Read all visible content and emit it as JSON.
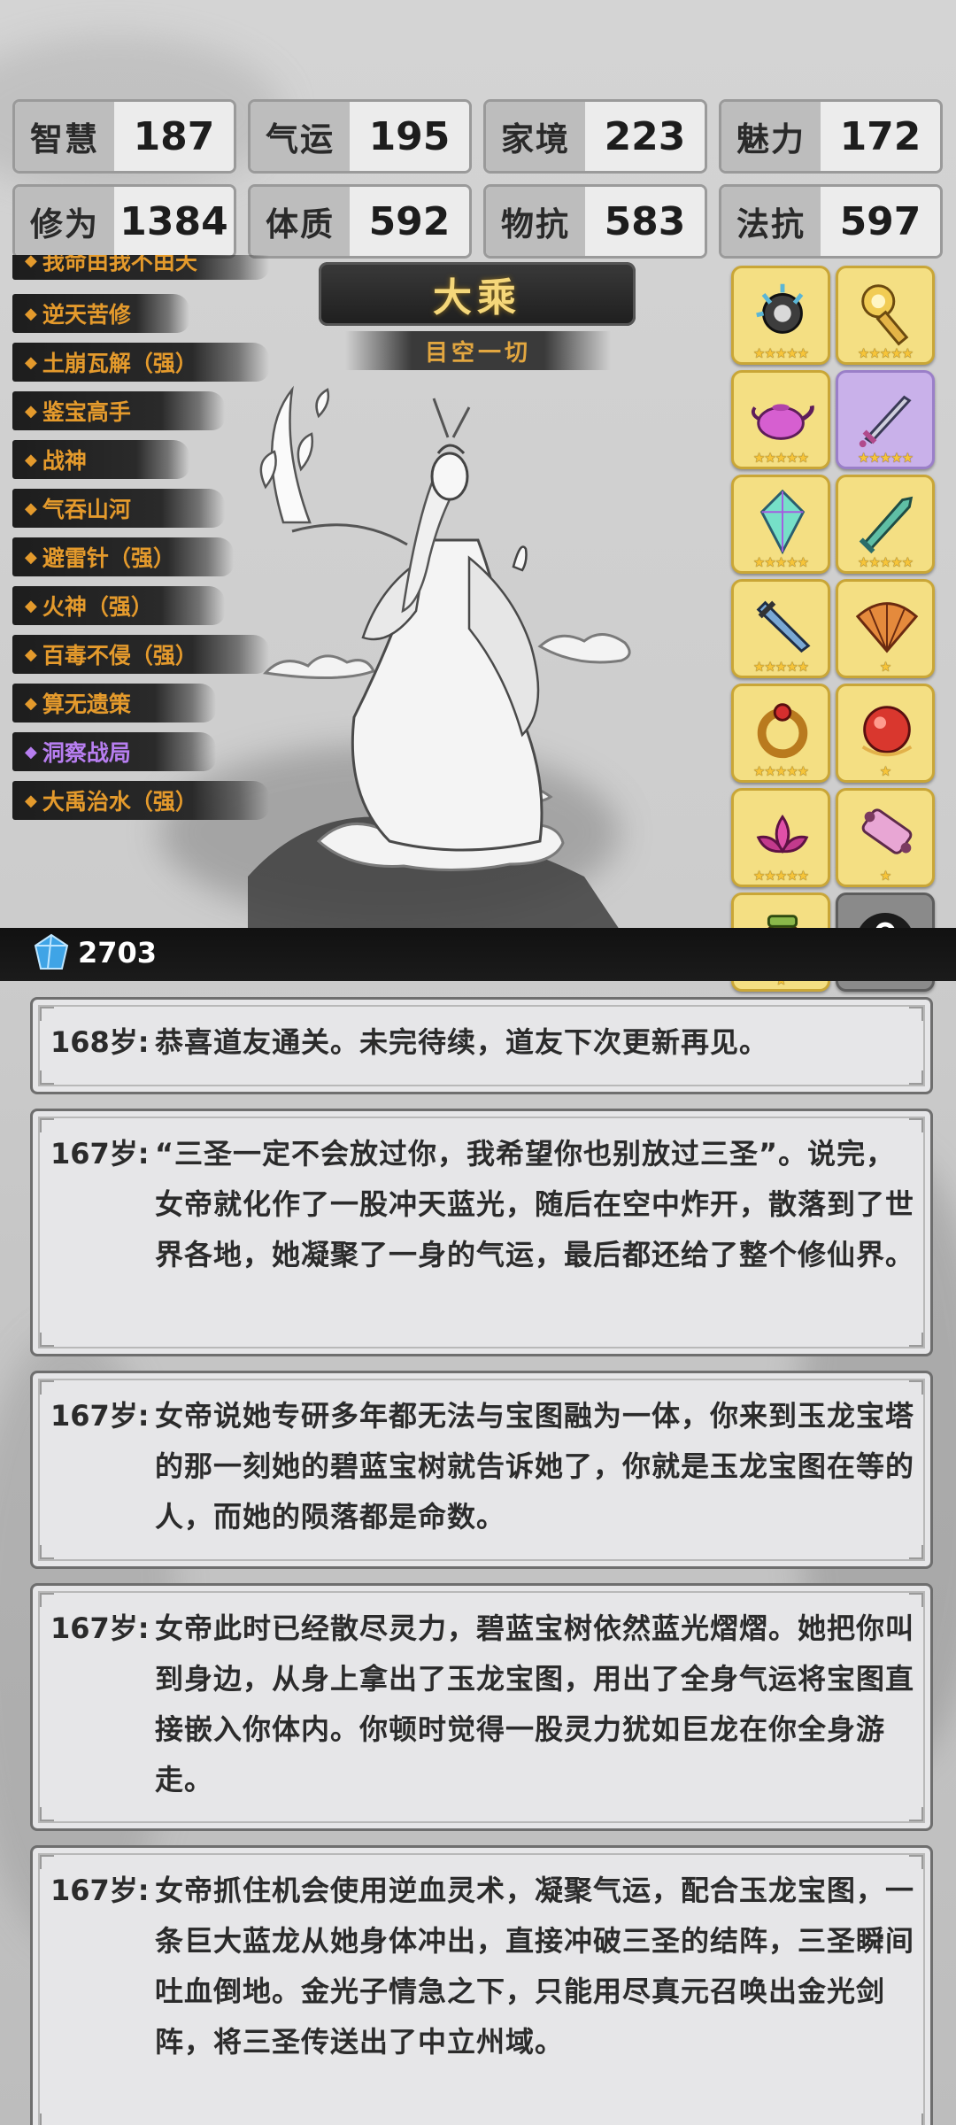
{
  "stats": [
    {
      "label": "智慧",
      "value": "187"
    },
    {
      "label": "气运",
      "value": "195"
    },
    {
      "label": "家境",
      "value": "223"
    },
    {
      "label": "魅力",
      "value": "172"
    },
    {
      "label": "修为",
      "value": "1384"
    },
    {
      "label": "体质",
      "value": "592"
    },
    {
      "label": "物抗",
      "value": "583"
    },
    {
      "label": "法抗",
      "value": "597"
    }
  ],
  "traits": [
    {
      "label": "我命由我不由天",
      "color": "#e49a2c"
    },
    {
      "label": "逆天苦修",
      "color": "#e49a2c"
    },
    {
      "label": "土崩瓦解（强）",
      "color": "#e49a2c"
    },
    {
      "label": "鉴宝高手",
      "color": "#e49a2c"
    },
    {
      "label": "战神",
      "color": "#e49a2c"
    },
    {
      "label": "气吞山河",
      "color": "#e49a2c"
    },
    {
      "label": "避雷针（强）",
      "color": "#e49a2c"
    },
    {
      "label": "火神（强）",
      "color": "#e49a2c"
    },
    {
      "label": "百毒不侵（强）",
      "color": "#e49a2c"
    },
    {
      "label": "算无遗策",
      "color": "#e49a2c"
    },
    {
      "label": "洞察战局",
      "color": "#b77ef0"
    },
    {
      "label": "大禹治水（强）",
      "color": "#e49a2c"
    }
  ],
  "realm": {
    "title": "大乘",
    "subtitle": "目空一切"
  },
  "equipment": [
    {
      "icon": "spiked-orb-icon",
      "stars": "★★★★★",
      "rarity": "gold"
    },
    {
      "icon": "golden-staff-icon",
      "stars": "★★★★★",
      "rarity": "gold"
    },
    {
      "icon": "teapot-icon",
      "stars": "★★★★★",
      "rarity": "gold"
    },
    {
      "icon": "sword-icon",
      "stars": "★★★★★",
      "rarity": "purple"
    },
    {
      "icon": "crystal-icon",
      "stars": "★★★★★",
      "rarity": "gold"
    },
    {
      "icon": "jade-dagger-icon",
      "stars": "★★★★★",
      "rarity": "gold"
    },
    {
      "icon": "blade-icon",
      "stars": "★★★★★",
      "rarity": "gold"
    },
    {
      "icon": "fan-icon",
      "stars": "★",
      "rarity": "gold"
    },
    {
      "icon": "ring-icon",
      "stars": "★★★★★",
      "rarity": "gold"
    },
    {
      "icon": "red-pearl-icon",
      "stars": "★",
      "rarity": "gold"
    },
    {
      "icon": "lotus-icon",
      "stars": "★★★★★",
      "rarity": "gold"
    },
    {
      "icon": "scroll-icon",
      "stars": "★",
      "rarity": "gold"
    },
    {
      "icon": "cauldron-icon",
      "stars": "★",
      "rarity": "gold"
    },
    {
      "icon": "lock-icon",
      "stars": "",
      "rarity": "locked"
    }
  ],
  "currency": {
    "gems": "2703"
  },
  "log": [
    {
      "age": "168岁:",
      "text": "恭喜道友通关。未完待续，道友下次更新再见。"
    },
    {
      "age": "167岁:",
      "text": "“三圣一定不会放过你，我希望你也别放过三圣”。说完，女帝就化作了一股冲天蓝光，随后在空中炸开，散落到了世界各地，她凝聚了一身的气运，最后都还给了整个修仙界。"
    },
    {
      "age": "167岁:",
      "text": "女帝说她专研多年都无法与宝图融为一体，你来到玉龙宝塔的那一刻她的碧蓝宝树就告诉她了，你就是玉龙宝图在等的人，而她的陨落都是命数。"
    },
    {
      "age": "167岁:",
      "text": "女帝此时已经散尽灵力，碧蓝宝树依然蓝光熠熠。她把你叫到身边，从身上拿出了玉龙宝图，用出了全身气运将宝图直接嵌入你体内。你顿时觉得一股灵力犹如巨龙在你全身游走。"
    },
    {
      "age": "167岁:",
      "text": "女帝抓住机会使用逆血灵术，凝聚气运，配合玉龙宝图，一条巨大蓝龙从她身体冲出，直接冲破三圣的结阵，三圣瞬间吐血倒地。金光子情急之下，只能用尽真元召唤出金光剑阵，将三圣传送出了中立州域。"
    }
  ]
}
